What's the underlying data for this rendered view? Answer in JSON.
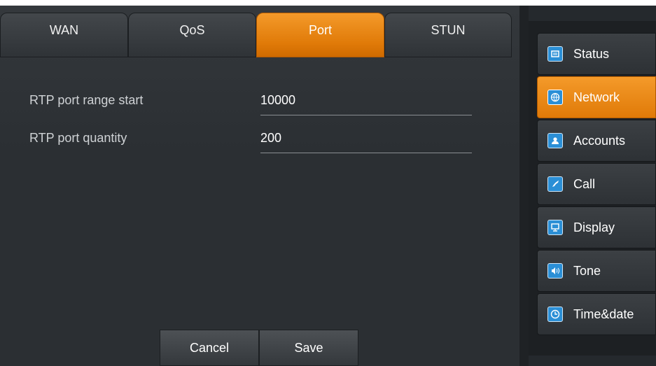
{
  "tabs": [
    {
      "label": "WAN"
    },
    {
      "label": "QoS"
    },
    {
      "label": "Port",
      "active": true
    },
    {
      "label": "STUN"
    }
  ],
  "form": {
    "rtp_start_label": "RTP port range start",
    "rtp_start_value": "10000",
    "rtp_quantity_label": "RTP port quantity",
    "rtp_quantity_value": "200"
  },
  "actions": {
    "cancel_label": "Cancel",
    "save_label": "Save"
  },
  "sidebar": {
    "items": [
      {
        "label": "Status",
        "icon": "status-icon",
        "active": false
      },
      {
        "label": "Network",
        "icon": "network-icon",
        "active": true
      },
      {
        "label": "Accounts",
        "icon": "accounts-icon",
        "active": false
      },
      {
        "label": "Call",
        "icon": "call-icon",
        "active": false
      },
      {
        "label": "Display",
        "icon": "display-icon",
        "active": false
      },
      {
        "label": "Tone",
        "icon": "tone-icon",
        "active": false
      },
      {
        "label": "Time&date",
        "icon": "clock-icon",
        "active": false
      }
    ]
  },
  "colors": {
    "accent": "#f08c1a",
    "panel": "#2b2f33",
    "icon_blue": "#2b8fd6"
  }
}
